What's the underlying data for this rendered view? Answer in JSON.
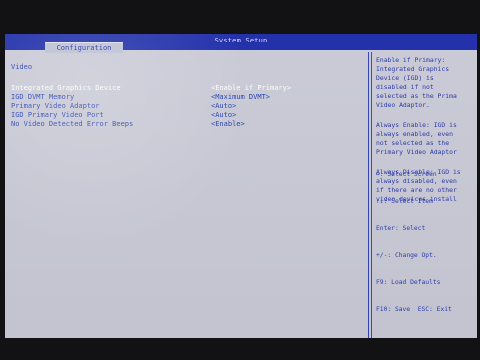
{
  "window": {
    "title": "System Setup",
    "active_tab": "Configuration"
  },
  "page": {
    "section_title": "Video",
    "settings": [
      {
        "label": "Integrated Graphics Device",
        "value": "<Enable if Primary>",
        "selected": true
      },
      {
        "label": "IGD DVMT Memory",
        "value": "<Maximum DVMT>",
        "selected": false
      },
      {
        "label": "Primary Video Adaptor",
        "value": "<Auto>",
        "selected": false
      },
      {
        "label": "IGD Primary Video Port",
        "value": "<Auto>",
        "selected": false
      },
      {
        "label": "No Video Detected Error Beeps",
        "value": "<Enable>",
        "selected": false
      }
    ]
  },
  "help": {
    "paragraphs": [
      "Enable if Primary:\nIntegrated Graphics\nDevice (IGD) is\ndisabled if not\nselected as the Prima\nVideo Adaptor.",
      "Always Enable: IGD is\nalways enabled, even\nnot selected as the\nPrimary Video Adaptor",
      "Always Disable: IGD is\nalways disabled, even\nif there are no other\nvideo devices install"
    ],
    "keys": [
      "↔: Select Screen",
      "↑↓: Select Item",
      "Enter: Select",
      "+/-: Change Opt.",
      "F9: Load Defaults",
      "F10: Save  ESC: Exit"
    ]
  },
  "colors": {
    "titlebar": "#1f2ea9",
    "screen_bg": "#c9cad6",
    "text_blue": "#314ab6",
    "selected_text": "#ffffff"
  }
}
